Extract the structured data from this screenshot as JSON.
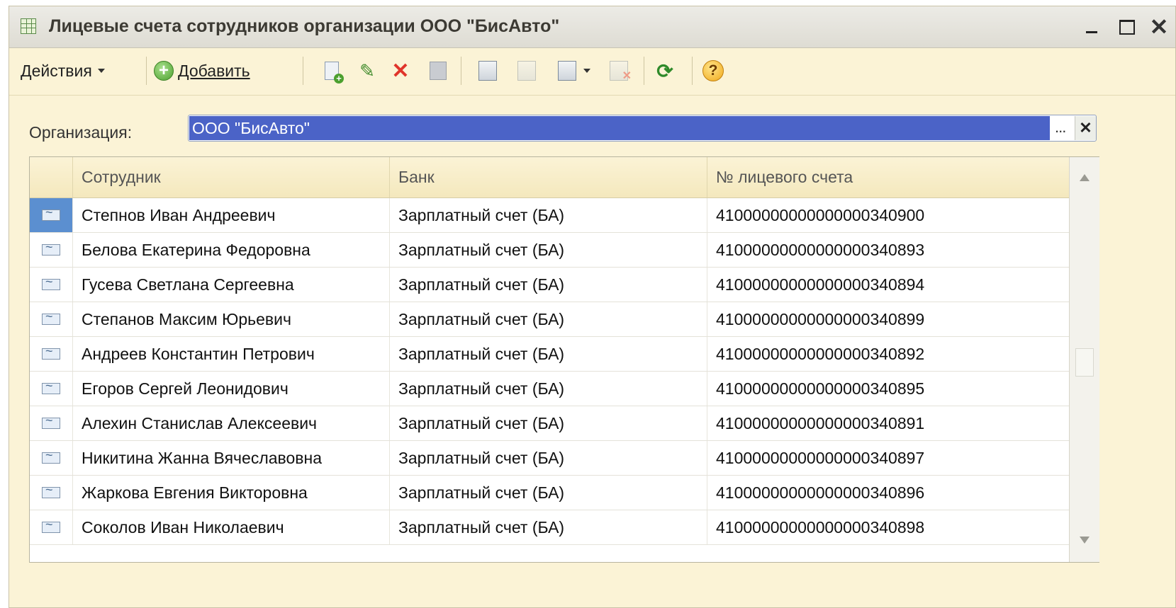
{
  "window": {
    "title": "Лицевые счета сотрудников организации ООО \"БисАвто\"",
    "close_glyph": "✕"
  },
  "toolbar": {
    "actions_label": "Действия",
    "add_label": "Добавить",
    "icons": [
      "add-copy-icon",
      "edit-icon",
      "delete-icon",
      "save-icon",
      "filter-icon",
      "filter-by-value-icon",
      "filter-dropdown-icon",
      "clear-filter-icon",
      "refresh-icon",
      "help-icon"
    ]
  },
  "filter": {
    "label": "Организация:",
    "value": "ООО \"БисАвто\"",
    "select_glyph": "...",
    "clear_glyph": "✕"
  },
  "table": {
    "columns": [
      "Сотрудник",
      "Банк",
      "№ лицевого счета"
    ],
    "rows": [
      {
        "employee": "Степнов Иван Андреевич",
        "bank": "Зарплатный счет (БА)",
        "account": "41000000000000000340900",
        "selected": true
      },
      {
        "employee": "Белова Екатерина Федоровна",
        "bank": "Зарплатный счет (БА)",
        "account": "41000000000000000340893"
      },
      {
        "employee": "Гусева Светлана Сергеевна",
        "bank": "Зарплатный счет (БА)",
        "account": "41000000000000000340894"
      },
      {
        "employee": "Степанов Максим Юрьевич",
        "bank": "Зарплатный счет (БА)",
        "account": "41000000000000000340899"
      },
      {
        "employee": "Андреев Константин Петрович",
        "bank": "Зарплатный счет (БА)",
        "account": "41000000000000000340892"
      },
      {
        "employee": "Егоров Сергей Леонидович",
        "bank": "Зарплатный счет (БА)",
        "account": "41000000000000000340895"
      },
      {
        "employee": "Алехин Станислав Алексеевич",
        "bank": "Зарплатный счет (БА)",
        "account": "41000000000000000340891"
      },
      {
        "employee": "Никитина Жанна Вячеславовна",
        "bank": "Зарплатный счет (БА)",
        "account": "41000000000000000340897"
      },
      {
        "employee": "Жаркова Евгения Викторовна",
        "bank": "Зарплатный счет (БА)",
        "account": "41000000000000000340896"
      },
      {
        "employee": "Соколов Иван Николаевич",
        "bank": "Зарплатный счет (БА)",
        "account": "41000000000000000340898"
      }
    ]
  },
  "colors": {
    "selection": "#4b63c7",
    "window_bg": "#fbf3d6"
  }
}
